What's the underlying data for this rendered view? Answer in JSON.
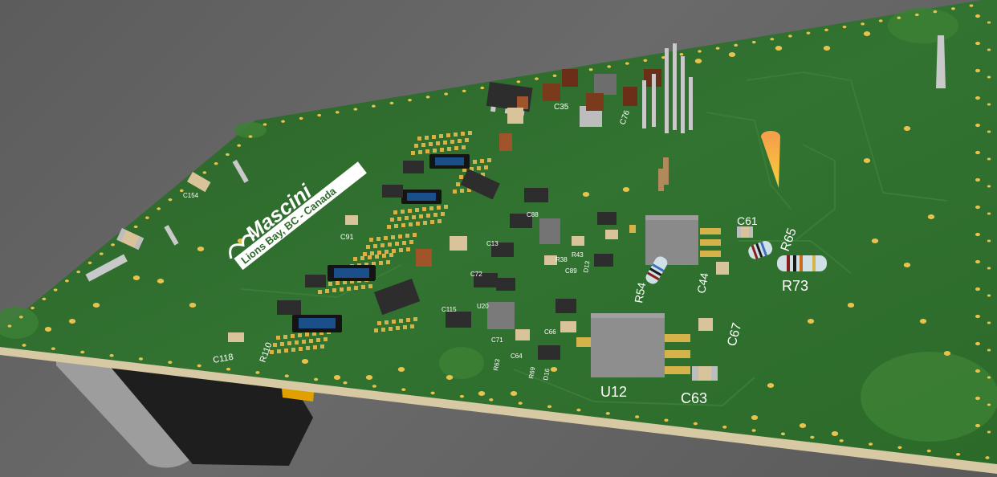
{
  "viewer": {
    "title": "",
    "background_color": "#636363"
  },
  "board": {
    "color": "#2f6b2a",
    "edge_color": "#d7c9a3",
    "copper_color": "#d6b24a",
    "logo_text": "Mascini",
    "location_text": "Lions Bay, BC - Canada"
  },
  "designators": {
    "C35": "C35",
    "C118": "C118",
    "C154": "C154",
    "C91": "C91",
    "C115": "C115",
    "C88": "C88",
    "C13": "C13",
    "C72": "C72",
    "C89": "C89",
    "C64": "C64",
    "C66": "C66",
    "C71": "C71",
    "C61": "C61",
    "C44": "C44",
    "C67": "C67",
    "C63": "C63",
    "C76": "C76",
    "R110": "R110",
    "R38": "R38",
    "R43": "R43",
    "R54": "R54",
    "R65": "R65",
    "R73": "R73",
    "R63": "R63",
    "R69": "R69",
    "U12": "U12",
    "U20": "U20",
    "D16": "D16",
    "D13": "D13"
  },
  "colors": {
    "ic_body": "#3a3a3a",
    "ic_pin": "#c9c9c9",
    "cap_ceramic": "#d9c39a",
    "cap_tantalum": "#7a3a1c",
    "resistor_body": "#cfe0e6",
    "chip_blue": "#1b4f8a",
    "drill": "#e8c24d"
  }
}
